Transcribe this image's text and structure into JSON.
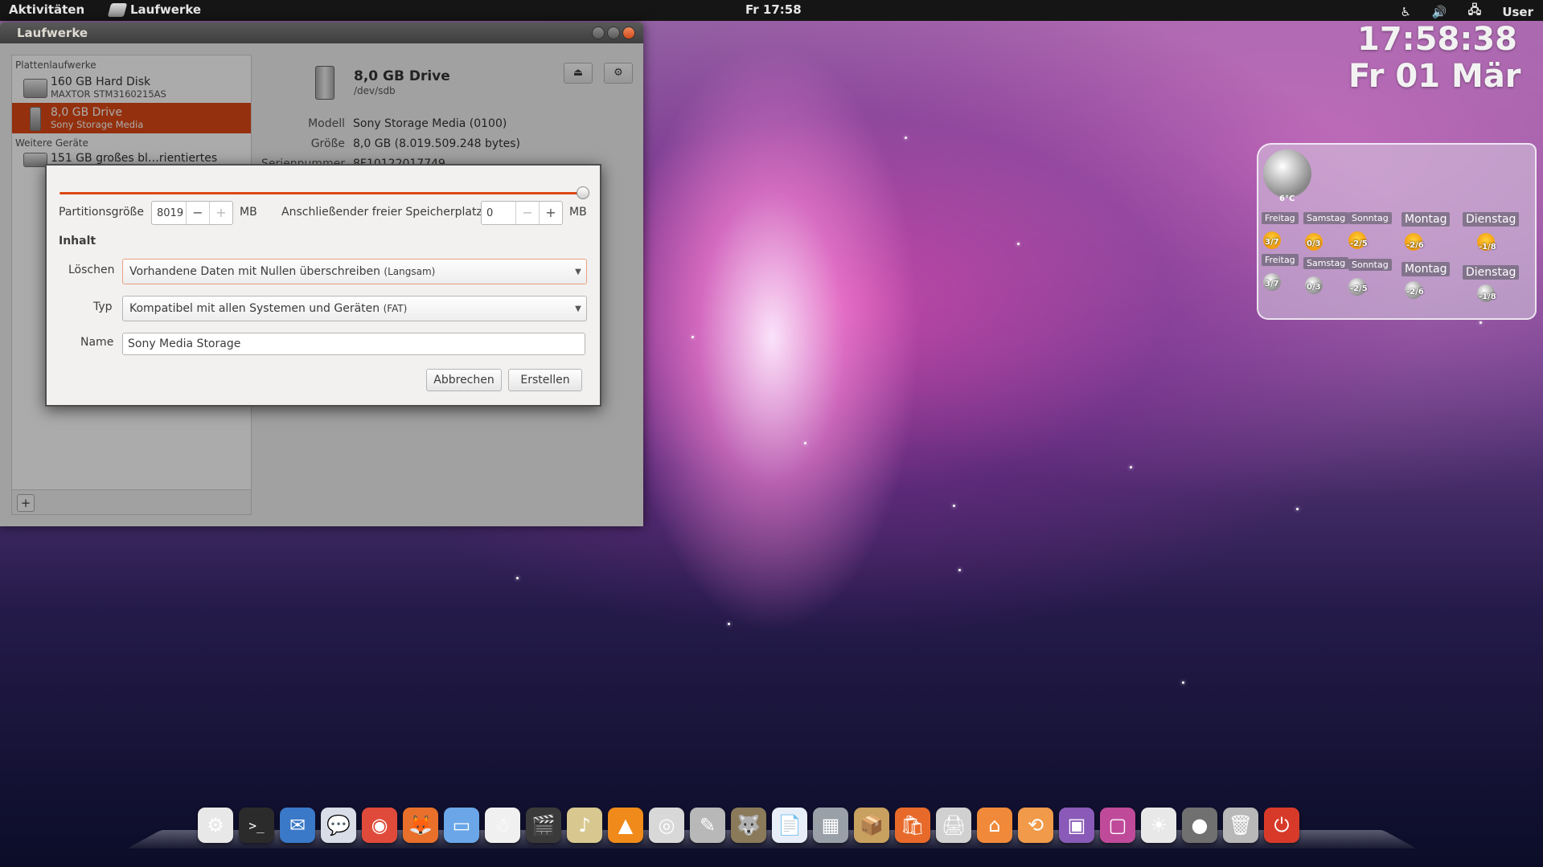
{
  "top_panel": {
    "activities": "Aktivitäten",
    "app_name": "Laufwerke",
    "clock": "Fr 17:58",
    "tray": {
      "accessibility": "♿",
      "volume": "🔊",
      "network": "🖧",
      "user": "User"
    }
  },
  "window": {
    "title": "Laufwerke",
    "sidebar": {
      "section1": "Plattenlaufwerke",
      "items": [
        {
          "name": "160 GB Hard Disk",
          "sub": "MAXTOR STM3160215AS"
        },
        {
          "name": "8,0 GB Drive",
          "sub": "Sony Storage Media"
        }
      ],
      "section2": "Weitere Geräte",
      "other_item": "151 GB großes bl…rientiertes Gerät",
      "add": "+"
    },
    "detail": {
      "title": "8,0 GB Drive",
      "device": "/dev/sdb",
      "eject_icon": "⏏",
      "settings_icon": "⚙",
      "props": [
        {
          "k": "Modell",
          "v": "Sony Storage Media (0100)"
        },
        {
          "k": "Größe",
          "v": "8,0 GB (8.019.509.248 bytes)"
        },
        {
          "k": "Seriennummer",
          "v": "8F10122017749"
        }
      ]
    }
  },
  "dialog": {
    "slider_fraction": 1.0,
    "size_label": "Partitionsgröße",
    "size_value": "8019",
    "size_unit": "MB",
    "free_label": "Anschließender freier Speicherplatz",
    "free_value": "0",
    "free_unit": "MB",
    "minus": "−",
    "plus": "+",
    "section": "Inhalt",
    "erase_label": "Löschen",
    "erase_value": "Vorhandene Daten mit Nullen überschreiben",
    "erase_note": "(Langsam)",
    "type_label": "Typ",
    "type_value": "Kompatibel mit allen Systemen und Geräten",
    "type_note": "(FAT)",
    "name_label": "Name",
    "name_value": "Sony Media Storage",
    "cancel": "Abbrechen",
    "create": "Erstellen"
  },
  "widgets": {
    "clock": "17:58:38",
    "date": "Fr 01 Mär",
    "weather": {
      "current_temp": "6°C",
      "days": [
        {
          "name": "Freitag",
          "day_val": "3/7",
          "night_val": "3/7"
        },
        {
          "name": "Samstag",
          "day_val": "0/3",
          "night_val": "0/3"
        },
        {
          "name": "Sonntag",
          "day_val": "-2/5",
          "night_val": "-2/5"
        },
        {
          "name": "Montag",
          "day_val": "-2/6",
          "night_val": "-2/6"
        },
        {
          "name": "Dienstag",
          "day_val": "-1/8",
          "night_val": "-1/8"
        }
      ]
    }
  },
  "dock": {
    "items": [
      {
        "name": "ubuntu-icon",
        "glyph": "⚙",
        "color": "#e8e8e8"
      },
      {
        "name": "terminal-icon",
        "glyph": ">_",
        "color": "#2b2b2b"
      },
      {
        "name": "thunderbird-icon",
        "glyph": "✉",
        "color": "#3a78c8"
      },
      {
        "name": "pidgin-icon",
        "glyph": "💬",
        "color": "#d8dde8"
      },
      {
        "name": "chrome-icon",
        "glyph": "◉",
        "color": "#e04a3a"
      },
      {
        "name": "firefox-icon",
        "glyph": "🦊",
        "color": "#e8702a"
      },
      {
        "name": "finder-icon",
        "glyph": "▭",
        "color": "#6aa6e8"
      },
      {
        "name": "skype-icon",
        "glyph": "☃",
        "color": "#f0f0f0"
      },
      {
        "name": "video-editor-icon",
        "glyph": "🎬",
        "color": "#3a3a3a"
      },
      {
        "name": "media-player-icon",
        "glyph": "♪",
        "color": "#d8c890"
      },
      {
        "name": "vlc-icon",
        "glyph": "▲",
        "color": "#f08a1a"
      },
      {
        "name": "dvd-icon",
        "glyph": "◎",
        "color": "#d8d8d8"
      },
      {
        "name": "gimp-brush-icon",
        "glyph": "✎",
        "color": "#b8b8b8"
      },
      {
        "name": "gimp-icon",
        "glyph": "🐺",
        "color": "#8a7a5a"
      },
      {
        "name": "writer-icon",
        "glyph": "📄",
        "color": "#e8eef8"
      },
      {
        "name": "calculator-icon",
        "glyph": "▦",
        "color": "#9aa0a8"
      },
      {
        "name": "archive-icon",
        "glyph": "📦",
        "color": "#c8a060"
      },
      {
        "name": "software-center-icon",
        "glyph": "🛍",
        "color": "#e86a2a"
      },
      {
        "name": "printer-icon",
        "glyph": "🖨",
        "color": "#d0d0d0"
      },
      {
        "name": "home-folder-icon",
        "glyph": "⌂",
        "color": "#f08a3a"
      },
      {
        "name": "backup-folder-icon",
        "glyph": "⟲",
        "color": "#f09a4a"
      },
      {
        "name": "workspace-switcher-icon",
        "glyph": "▣",
        "color": "#8a5ab8"
      },
      {
        "name": "wallpaper-icon",
        "glyph": "▢",
        "color": "#c04a9a"
      },
      {
        "name": "brightness-icon",
        "glyph": "☀",
        "color": "#e8e8e8"
      },
      {
        "name": "disk-icon",
        "glyph": "●",
        "color": "#707070"
      },
      {
        "name": "trash-icon",
        "glyph": "🗑",
        "color": "#b8b8b8"
      },
      {
        "name": "power-icon",
        "glyph": "⏻",
        "color": "#d83a2a"
      }
    ]
  }
}
